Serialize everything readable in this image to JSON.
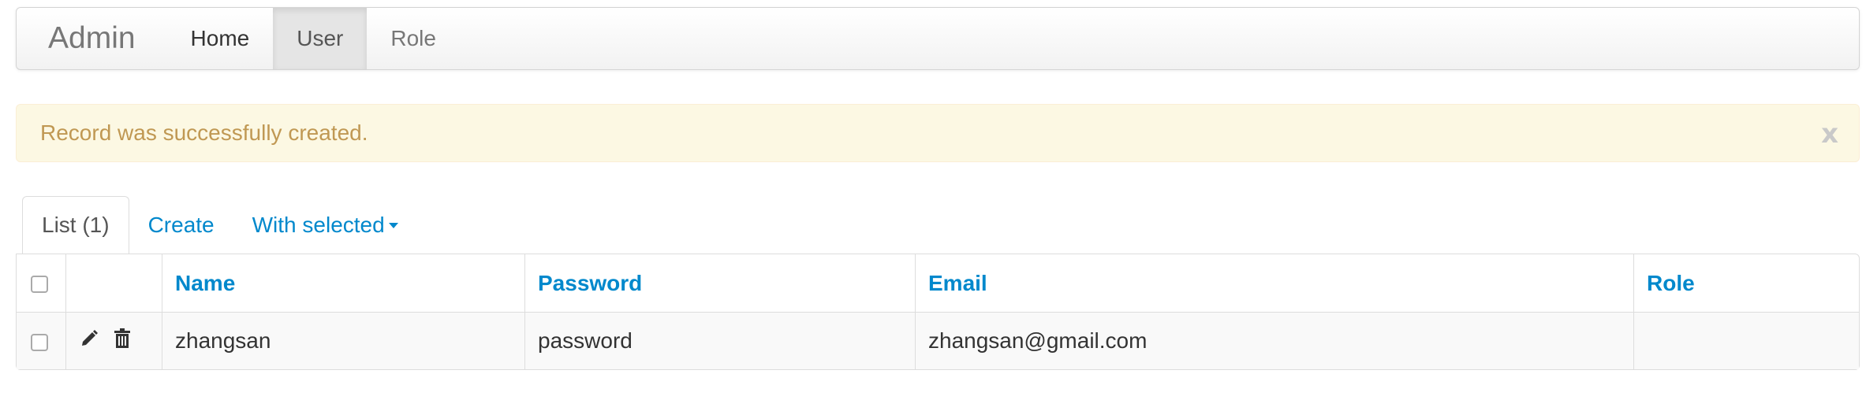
{
  "navbar": {
    "brand": "Admin",
    "items": [
      {
        "label": "Home"
      },
      {
        "label": "User",
        "active": true
      },
      {
        "label": "Role"
      }
    ]
  },
  "alert": {
    "message": "Record was successfully created.",
    "close_label": "x"
  },
  "tabs": {
    "list": "List (1)",
    "create": "Create",
    "with_selected": "With selected"
  },
  "table": {
    "columns": [
      "Name",
      "Password",
      "Email",
      "Role"
    ],
    "rows": [
      {
        "name": "zhangsan",
        "password": "password",
        "email": "zhangsan@gmail.com",
        "role": ""
      }
    ],
    "row_icons": [
      "pencil-icon",
      "trash-icon"
    ]
  },
  "colors": {
    "link": "#0088cc",
    "alert_bg": "#fcf8e3",
    "alert_text": "#c09853"
  }
}
